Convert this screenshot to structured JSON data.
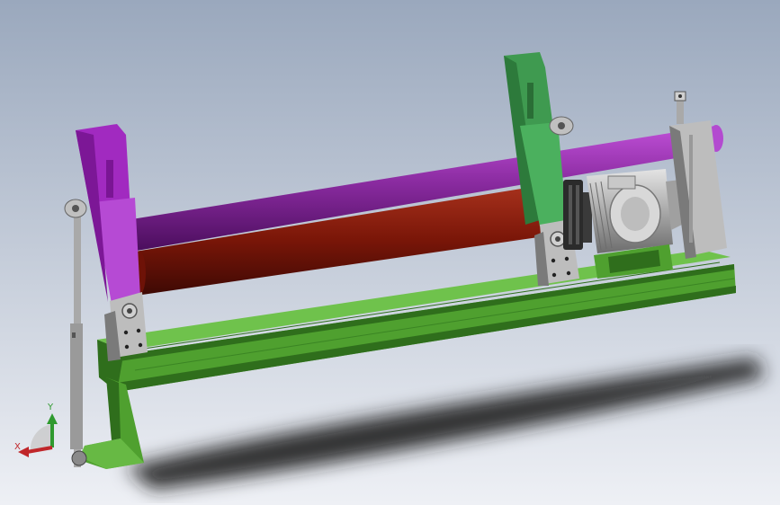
{
  "colors": {
    "background_top": "#9aa8bd",
    "background_bottom": "#eef0f5",
    "frame_green": "#4fa02f",
    "frame_green_dark": "#2f6e1c",
    "frame_green_light": "#6fc24c",
    "side_frame_purple": "#a12ac0",
    "side_frame_green": "#3f9a50",
    "plate_gray": "#bdbdbd",
    "plate_gray_dark": "#7a7a7a",
    "top_roll_purple": "#8a2ba0",
    "bottom_roll_red": "#8c1b0e",
    "motor_gray": "#b3b3b3",
    "shaft_gray": "#a9a9a9",
    "shadow": "#1e1e1e"
  },
  "triad": {
    "x_label": "X",
    "y_label": "Y",
    "x_color": "#c0262a",
    "y_color": "#2f9a2f"
  }
}
